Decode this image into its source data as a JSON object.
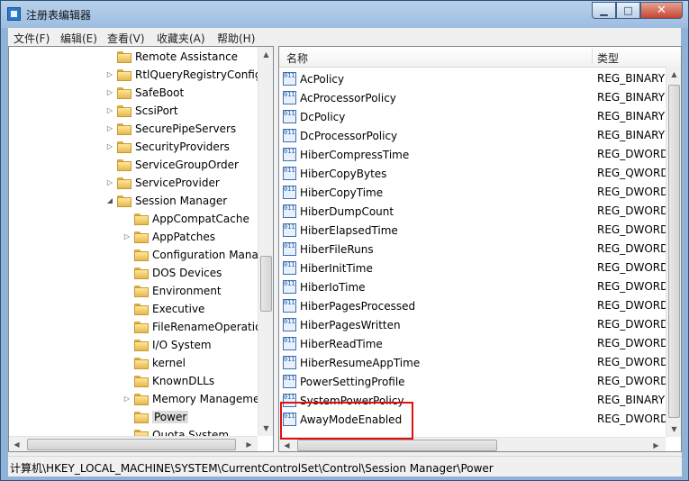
{
  "window": {
    "title": "注册表编辑器"
  },
  "menu": [
    "文件(F)",
    "编辑(E)",
    "查看(V)",
    "收藏夹(A)",
    "帮助(H)"
  ],
  "tree": [
    {
      "label": "Remote Assistance",
      "level": 0,
      "expander": ""
    },
    {
      "label": "RtlQueryRegistryConfig",
      "level": 0,
      "expander": "▷"
    },
    {
      "label": "SafeBoot",
      "level": 0,
      "expander": "▷"
    },
    {
      "label": "ScsiPort",
      "level": 0,
      "expander": "▷"
    },
    {
      "label": "SecurePipeServers",
      "level": 0,
      "expander": "▷"
    },
    {
      "label": "SecurityProviders",
      "level": 0,
      "expander": "▷"
    },
    {
      "label": "ServiceGroupOrder",
      "level": 0,
      "expander": ""
    },
    {
      "label": "ServiceProvider",
      "level": 0,
      "expander": "▷"
    },
    {
      "label": "Session Manager",
      "level": 0,
      "expander": "◢"
    },
    {
      "label": "AppCompatCache",
      "level": 1,
      "expander": ""
    },
    {
      "label": "AppPatches",
      "level": 1,
      "expander": "▷"
    },
    {
      "label": "Configuration Mana",
      "level": 1,
      "expander": ""
    },
    {
      "label": "DOS Devices",
      "level": 1,
      "expander": ""
    },
    {
      "label": "Environment",
      "level": 1,
      "expander": ""
    },
    {
      "label": "Executive",
      "level": 1,
      "expander": ""
    },
    {
      "label": "FileRenameOperatio",
      "level": 1,
      "expander": ""
    },
    {
      "label": "I/O System",
      "level": 1,
      "expander": ""
    },
    {
      "label": "kernel",
      "level": 1,
      "expander": ""
    },
    {
      "label": "KnownDLLs",
      "level": 1,
      "expander": ""
    },
    {
      "label": "Memory Manageme",
      "level": 1,
      "expander": "▷"
    },
    {
      "label": "Power",
      "level": 1,
      "expander": "",
      "selected": true
    },
    {
      "label": "Quota System",
      "level": 1,
      "expander": ""
    }
  ],
  "list": {
    "columns": [
      "名称",
      "类型"
    ],
    "rows": [
      {
        "name": "AcPolicy",
        "type": "REG_BINARY"
      },
      {
        "name": "AcProcessorPolicy",
        "type": "REG_BINARY"
      },
      {
        "name": "DcPolicy",
        "type": "REG_BINARY"
      },
      {
        "name": "DcProcessorPolicy",
        "type": "REG_BINARY"
      },
      {
        "name": "HiberCompressTime",
        "type": "REG_DWORD"
      },
      {
        "name": "HiberCopyBytes",
        "type": "REG_QWORD"
      },
      {
        "name": "HiberCopyTime",
        "type": "REG_DWORD"
      },
      {
        "name": "HiberDumpCount",
        "type": "REG_DWORD"
      },
      {
        "name": "HiberElapsedTime",
        "type": "REG_DWORD"
      },
      {
        "name": "HiberFileRuns",
        "type": "REG_DWORD"
      },
      {
        "name": "HiberInitTime",
        "type": "REG_DWORD"
      },
      {
        "name": "HiberIoTime",
        "type": "REG_DWORD"
      },
      {
        "name": "HiberPagesProcessed",
        "type": "REG_DWORD"
      },
      {
        "name": "HiberPagesWritten",
        "type": "REG_DWORD"
      },
      {
        "name": "HiberReadTime",
        "type": "REG_DWORD"
      },
      {
        "name": "HiberResumeAppTime",
        "type": "REG_DWORD"
      },
      {
        "name": "PowerSettingProfile",
        "type": "REG_DWORD"
      },
      {
        "name": "SystemPowerPolicy",
        "type": "REG_BINARY"
      },
      {
        "name": "AwayModeEnabled",
        "type": "REG_DWORD"
      }
    ]
  },
  "highlight_color": "#e01010",
  "reg_icon_text": "011\n110",
  "status": {
    "path": "计算机\\HKEY_LOCAL_MACHINE\\SYSTEM\\CurrentControlSet\\Control\\Session Manager\\Power"
  }
}
